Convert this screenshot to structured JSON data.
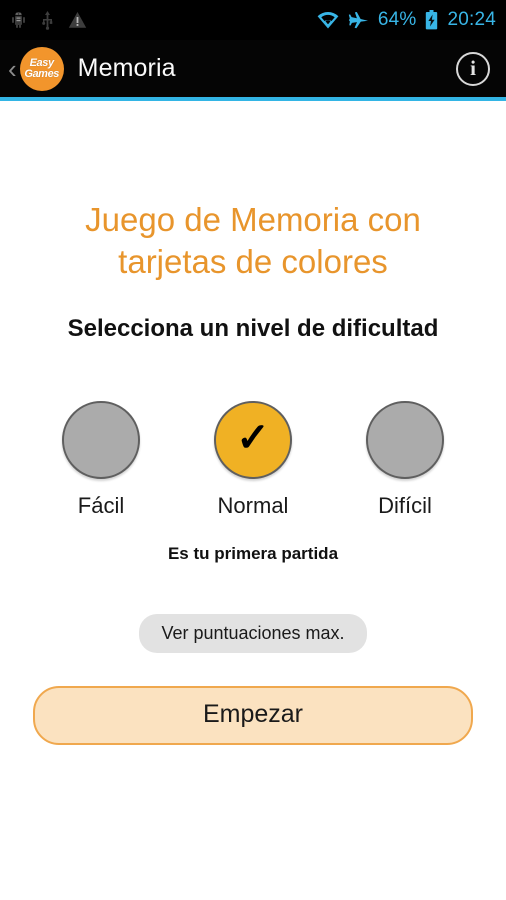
{
  "status_bar": {
    "left_icons": [
      {
        "name": "android-debug-icon",
        "glyph": "android"
      },
      {
        "name": "usb-icon",
        "glyph": "usb"
      },
      {
        "name": "warning-icon",
        "glyph": "warning"
      }
    ],
    "wifi_icon": "wifi-icon",
    "airplane_icon": "airplane-mode-icon",
    "battery_percent": "64%",
    "battery_icon": "battery-charging-icon",
    "time": "20:24",
    "accent_color": "#33b5e5"
  },
  "action_bar": {
    "back_label": "‹",
    "logo_line1": "Easy",
    "logo_line2": "Games",
    "logo_color": "#f2952c",
    "title": "Memoria",
    "info_label": "i",
    "rule_color": "#33b5e5"
  },
  "main": {
    "headline": "Juego de Memoria con tarjetas de colores",
    "headline_color": "#e8952c",
    "subhead": "Selecciona un nivel de dificultad",
    "levels": [
      {
        "label": "Fácil",
        "selected": false,
        "color": "#ababab"
      },
      {
        "label": "Normal",
        "selected": true,
        "color": "#f0b124",
        "check": "✓"
      },
      {
        "label": "Difícil",
        "selected": false,
        "color": "#ababab"
      }
    ],
    "note": "Es tu primera partida",
    "scores_button": "Ver puntuaciones max.",
    "start_button": "Empezar"
  }
}
